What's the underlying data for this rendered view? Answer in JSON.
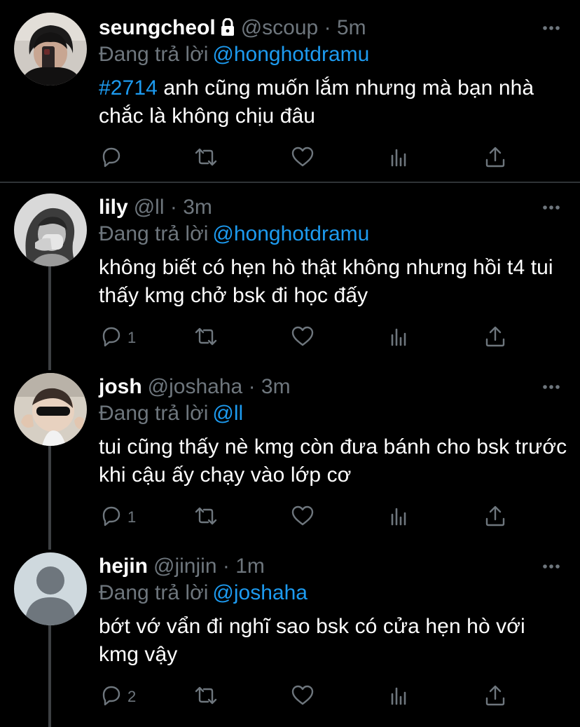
{
  "tweets": [
    {
      "name": "seungcheol",
      "locked": true,
      "handle": "@scoup",
      "dot": "·",
      "time": "5m",
      "replying_label": "Đang trả lời",
      "replying_to": "@honghotdramu",
      "hashtag": "#2714",
      "text": "anh cũng muốn lắm nhưng mà bạn nhà chắc là không chịu đâu",
      "reply_count": ""
    },
    {
      "name": "lily",
      "handle": "@ll",
      "dot": "·",
      "time": "3m",
      "replying_label": "Đang trả lời",
      "replying_to": "@honghotdramu",
      "text": "không biết có hẹn hò thật không nhưng hồi t4 tui thấy kmg chở bsk đi học đấy",
      "reply_count": "1"
    },
    {
      "name": "josh",
      "handle": "@joshaha",
      "dot": "·",
      "time": "3m",
      "replying_label": "Đang trả lời",
      "replying_to": "@ll",
      "text": "tui cũng thấy nè kmg còn đưa bánh cho bsk trước khi cậu ấy chạy vào lớp cơ",
      "reply_count": "1"
    },
    {
      "name": "hejin",
      "handle": "@jinjin",
      "dot": "·",
      "time": "1m",
      "replying_label": "Đang trả lời",
      "replying_to": "@joshaha",
      "text": "bớt vớ vẩn đi nghĩ sao bsk có cửa hẹn hò với kmg vậy",
      "reply_count": "2"
    }
  ],
  "icons": {
    "reply": "reply-icon",
    "retweet": "retweet-icon",
    "like": "heart-icon",
    "analytics": "analytics-icon",
    "share": "share-icon",
    "more": "more-icon",
    "lock": "lock-icon"
  },
  "colors": {
    "background": "#000000",
    "text": "#ffffff",
    "secondary": "#6e767d",
    "link": "#1d9bf0",
    "divider": "#2f3336",
    "thread_line": "#3d4043"
  }
}
